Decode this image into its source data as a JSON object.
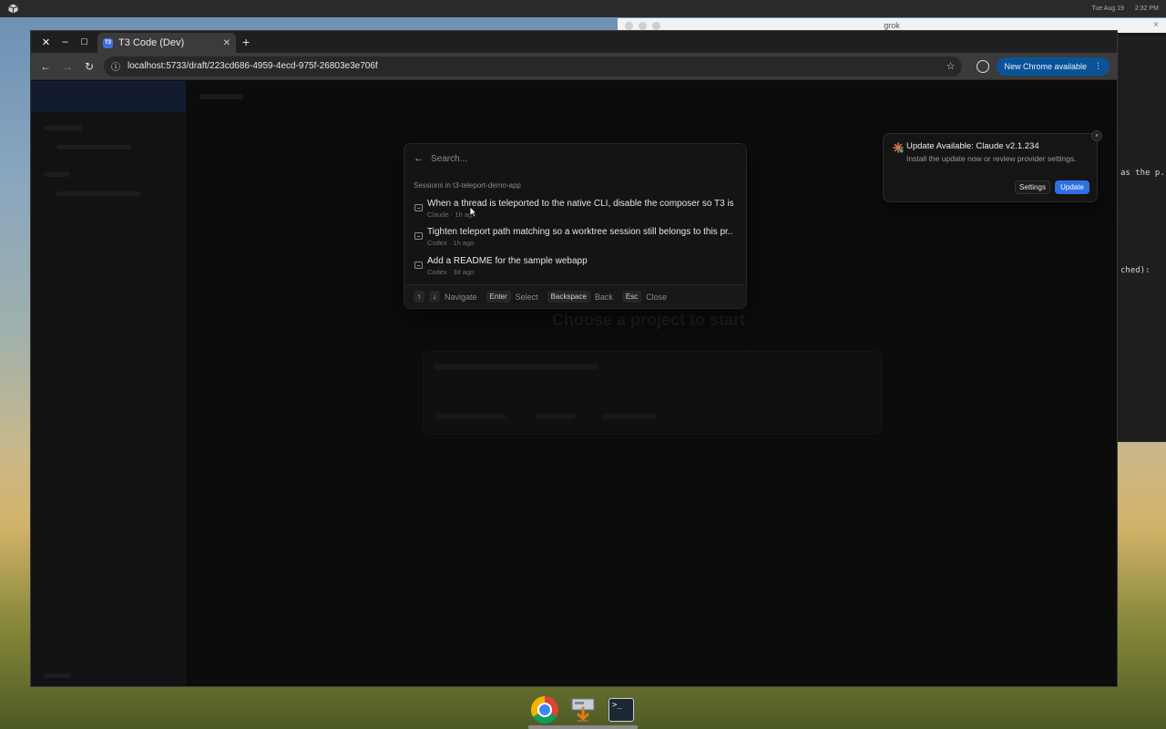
{
  "os": {
    "clock_date": "Tue Aug 19",
    "clock_time": "2:32 PM"
  },
  "background_window": {
    "title": "grok",
    "close": "×",
    "terminal_fragment_1": "as the p...",
    "terminal_fragment_2": "ched):"
  },
  "browser": {
    "close": "✕",
    "minimize": "–",
    "maximize": "□",
    "tab": {
      "favicon": "T3",
      "title": "T3 Code (Dev)",
      "close": "✕"
    },
    "newtab": "+",
    "back": "←",
    "forward": "→",
    "reload": "↻",
    "site_info": "ⓘ",
    "url": "localhost:5733/draft/223cd686-4959-4ecd-975f-26803e3e706f",
    "bookmark_star": "☆",
    "update_chip_label": "New Chrome available",
    "menu": "⋮"
  },
  "page": {
    "heading": "Choose a project to start"
  },
  "palette": {
    "search_placeholder": "Search...",
    "back_icon": "←",
    "group_label": "Sessions in t3-teleport-demo-app",
    "items": [
      {
        "title": "When a thread is teleported to the native CLI, disable the composer so T3 is...",
        "meta": "Claude · 1h ago"
      },
      {
        "title": "Tighten teleport path matching so a worktree session still belongs to this pr...",
        "meta": "Codex · 1h ago"
      },
      {
        "title": "Add a README for the sample webapp",
        "meta": "Codex · 3d ago"
      }
    ],
    "footer": {
      "up": "↑",
      "down": "↓",
      "navigate": "Navigate",
      "enter_key": "Enter",
      "select": "Select",
      "backspace_key": "Backspace",
      "back": "Back",
      "esc_key": "Esc",
      "close": "Close"
    }
  },
  "toast": {
    "title": "Update Available: Claude v2.1.234",
    "body": "Install the update now or review provider settings.",
    "close": "×",
    "settings_label": "Settings",
    "update_label": "Update"
  },
  "taskbar": {
    "terminal_glyph": ">_"
  }
}
